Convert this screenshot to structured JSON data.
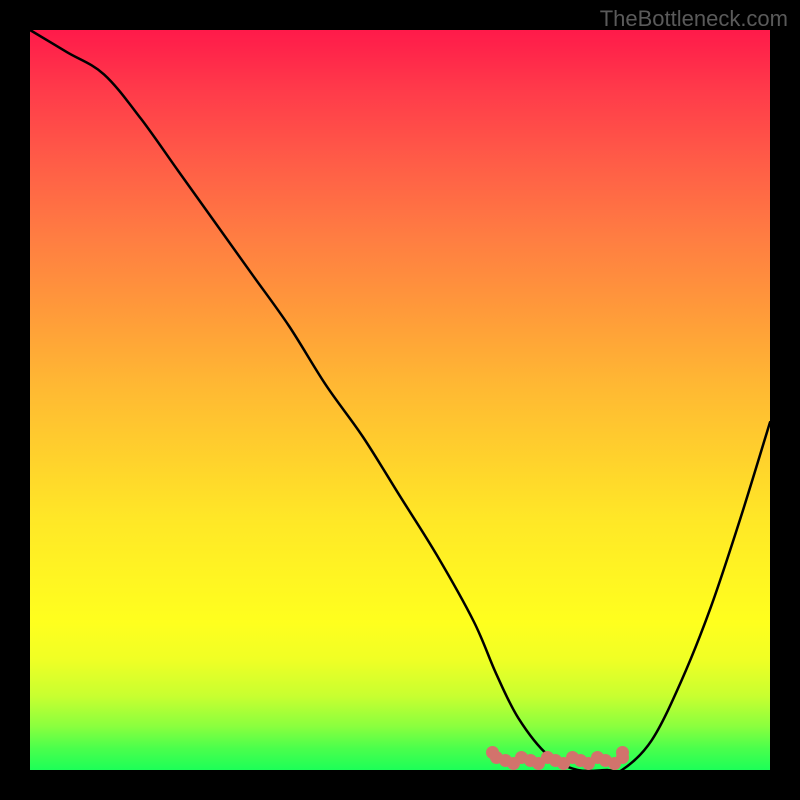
{
  "watermark": "TheBottleneck.com",
  "chart_data": {
    "type": "line",
    "title": "",
    "xlabel": "",
    "ylabel": "",
    "xlim": [
      0,
      100
    ],
    "ylim": [
      0,
      100
    ],
    "series": [
      {
        "name": "curve",
        "x": [
          0,
          5,
          10,
          15,
          20,
          25,
          30,
          35,
          40,
          45,
          50,
          55,
          60,
          63,
          66,
          70,
          74,
          78,
          80,
          84,
          88,
          92,
          96,
          100
        ],
        "values": [
          100,
          97,
          94,
          88,
          81,
          74,
          67,
          60,
          52,
          45,
          37,
          29,
          20,
          13,
          7,
          2,
          0,
          0,
          0,
          4,
          12,
          22,
          34,
          47
        ]
      }
    ],
    "marker_band": {
      "x_start": 63,
      "x_end": 80,
      "color": "#d2736c"
    }
  }
}
